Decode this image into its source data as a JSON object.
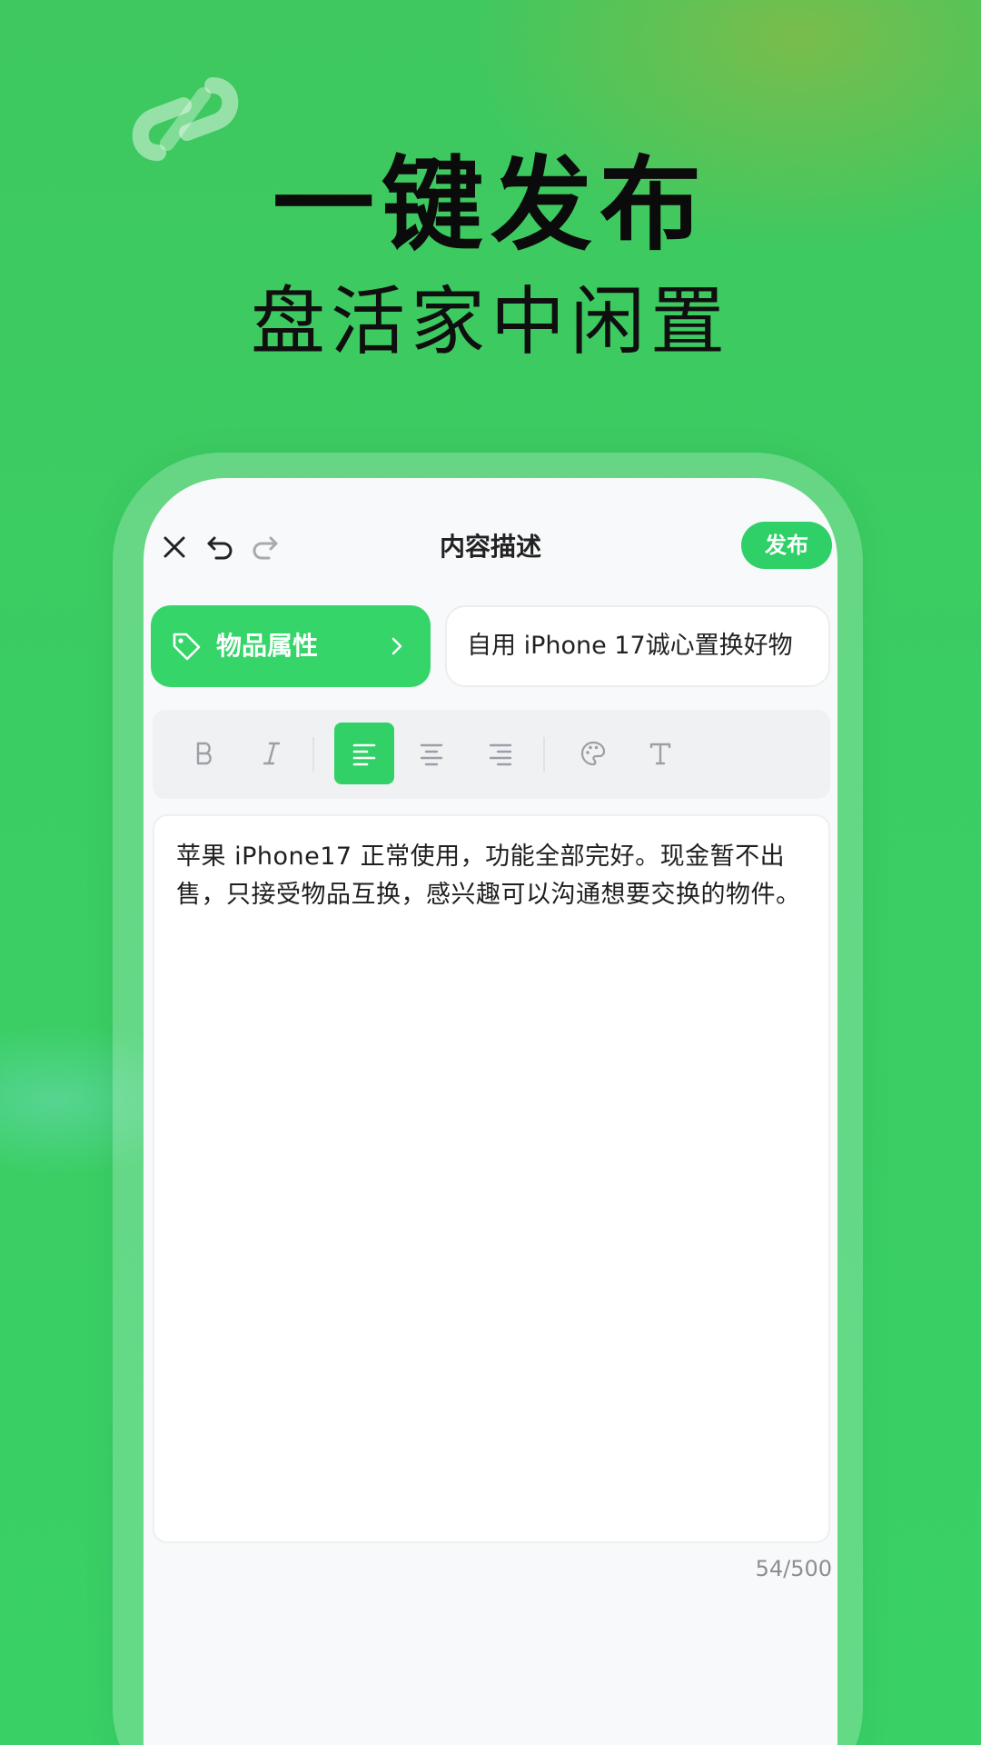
{
  "promo": {
    "headline": "一键发布",
    "subheadline": "盘活家中闲置"
  },
  "topbar": {
    "close_icon": "close-icon",
    "undo_icon": "undo-icon",
    "redo_icon": "redo-icon",
    "title": "内容描述",
    "publish_label": "发布"
  },
  "attributes": {
    "label": "物品属性",
    "icon": "tag-icon"
  },
  "title_field": {
    "value": "自用 iPhone 17诚心置换好物"
  },
  "toolbar": {
    "tools": [
      "bold-icon",
      "italic-icon",
      "align-left-icon",
      "align-center-icon",
      "align-right-icon",
      "palette-icon",
      "text-style-icon"
    ],
    "active": "align-left-icon"
  },
  "editor": {
    "content": "苹果 iPhone17 正常使用，功能全部完好。现金暂不出售，只接受物品互换，感兴趣可以沟通想要交换的物件。",
    "counter": "54/500"
  },
  "colors": {
    "accent": "#32d167",
    "background": "#3acd63"
  }
}
